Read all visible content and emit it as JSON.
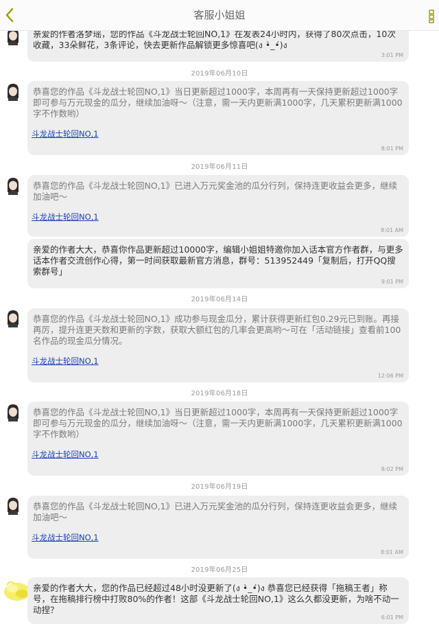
{
  "header": {
    "title": "客服小姐姐"
  },
  "icons": {
    "back": "chevron-left-icon",
    "more": "more-vertical-icon",
    "accent": "#9a9a00",
    "link_color": "#1a3db5"
  },
  "messages": [
    {
      "text": "亲爱的作者洛梦瑶，您的作品《斗龙战士轮回NO,1》在发表24小时内，获得了80次点击，10次收藏，33朵鲜花，3条评论，快去更新作品解锁更多惊喜吧(ง •̀_•́)ง",
      "time": "3:01 PM"
    },
    {
      "date": "2019年06月10日",
      "text": "恭喜您的作品《斗龙战士轮回NO,1》当日更新超过1000字，本周再有一天保持更新超过1000字即可参与万元现金的瓜分，继续加油呀～（注意，需一天内更新满1000字，几天累积更新满1000字不作数哟）",
      "link": "斗龙战士轮回NO,1",
      "time": "8:01 PM"
    },
    {
      "date": "2019年06月11日",
      "text": "恭喜您的作品《斗龙战士轮回NO,1》已进入万元奖金池的瓜分行列，保持连更收益会更多，继续加油吧～",
      "link": "斗龙战士轮回NO,1",
      "time": "8:01 AM"
    },
    {
      "text": "亲爱的作者大大，恭喜你作品更新超过10000字，编辑小姐姐特邀你加入话本官方作者群，与更多话本作者交流创作心得，第一时间获取最新官方消息，群号：513952449「复制后，打开QQ搜索群号」",
      "time": "9:01 PM"
    },
    {
      "date": "2019年06月14日",
      "text": "恭喜您的作品《斗龙战士轮回NO,1》成功参与现金瓜分，累计获得更新红包0.29元已到账。再接再厉，提升连更天数和更新的字数，获取大额红包的几率会更高哟～可在「活动链接」查看前100名作品的现金瓜分情况。",
      "link": "斗龙战士轮回NO,1",
      "time": "12:06 PM"
    },
    {
      "date": "2019年06月18日",
      "text": "恭喜您的作品《斗龙战士轮回NO,1》当日更新超过1000字，本周再有一天保持更新超过1000字即可参与万元现金的瓜分，继续加油呀～（注意，需一天内更新满1000字，几天累积更新满1000字不作数哟）",
      "link": "斗龙战士轮回NO,1",
      "time": "8:02 PM"
    },
    {
      "date": "2019年06月19日",
      "text": "恭喜您的作品《斗龙战士轮回NO,1》已进入万元奖金池的瓜分行列，保持连更收益会更多，继续加油吧～",
      "link": "斗龙战士轮回NO,1",
      "time": "8:01 AM"
    },
    {
      "date": "2019年06月25日",
      "text": "亲爱的作者大大，您的作品已经超过48小时没更新了(ง •̀_•́)ง 恭喜您已经获得「拖稿王者」称号，在拖稿排行榜中打败80%的作者！这部《斗龙战士轮回NO,1》这么久都没更新，为啥不动一动捏？",
      "time": "6:01 PM"
    }
  ]
}
